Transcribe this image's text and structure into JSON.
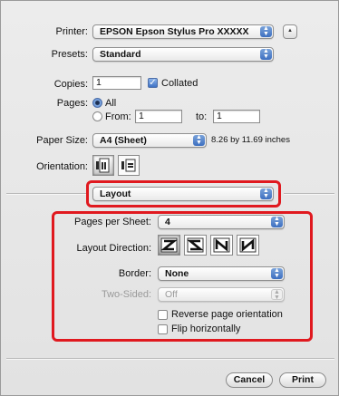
{
  "printer": {
    "label": "Printer:",
    "value": "EPSON Epson Stylus Pro XXXXX"
  },
  "presets": {
    "label": "Presets:",
    "value": "Standard"
  },
  "copies": {
    "label": "Copies:",
    "value": "1",
    "collated_label": "Collated",
    "collated": true
  },
  "pages": {
    "label": "Pages:",
    "all_label": "All",
    "from_label": "From:",
    "from_value": "1",
    "to_label": "to:",
    "to_value": "1"
  },
  "paper_size": {
    "label": "Paper Size:",
    "value": "A4 (Sheet)",
    "dimensions": "8.26 by 11.69 inches"
  },
  "orientation": {
    "label": "Orientation:"
  },
  "section_popup": {
    "value": "Layout"
  },
  "layout": {
    "pages_per_sheet": {
      "label": "Pages per Sheet:",
      "value": "4"
    },
    "direction": {
      "label": "Layout Direction:"
    },
    "border": {
      "label": "Border:",
      "value": "None"
    },
    "two_sided": {
      "label": "Two-Sided:",
      "value": "Off"
    },
    "reverse_label": "Reverse page orientation",
    "flip_label": "Flip horizontally"
  },
  "buttons": {
    "cancel": "Cancel",
    "print": "Print"
  },
  "colors": {
    "highlight": "#e0191f",
    "accent": "#3f72c5"
  }
}
